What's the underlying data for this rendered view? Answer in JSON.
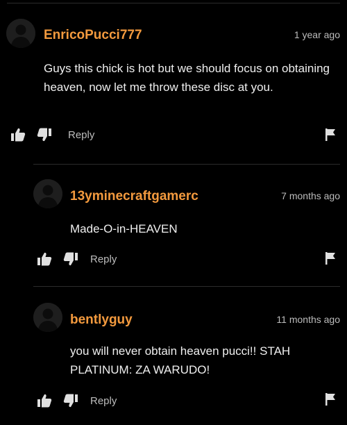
{
  "comments": [
    {
      "username": "EnricoPucci777",
      "timestamp": "1 year ago",
      "text": "Guys this chick is hot but we should focus on obtaining heaven, now let me throw these disc at you.",
      "reply_label": "Reply"
    },
    {
      "username": "13yminecraftgamerc",
      "timestamp": "7 months ago",
      "text": "Made-O-in-HEAVEN",
      "reply_label": "Reply"
    },
    {
      "username": "bentlyguy",
      "timestamp": "11 months ago",
      "text": "you will never obtain heaven pucci!! STAH PLATINUM: ZA WARUDO!",
      "reply_label": "Reply"
    }
  ],
  "icons": {
    "like": "thumbs-up-icon",
    "dislike": "thumbs-down-icon",
    "flag": "flag-icon",
    "avatar": "default-avatar"
  },
  "colors": {
    "username": "#f39a3e",
    "background": "#000000",
    "muted": "#bdbdbd"
  }
}
